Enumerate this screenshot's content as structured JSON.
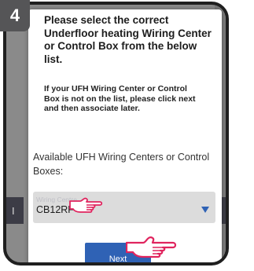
{
  "step": {
    "number": "4"
  },
  "dialog": {
    "title": "Please select the correct Underfloor heating Wiring Center or Control Box from the below list.",
    "note": "If your UFH Wiring Center or Control Box is not on the list, please click next and then associate later.",
    "available_label": "Available UFH Wiring Centers or Control Boxes:",
    "select": {
      "label": "Wiring Centre",
      "value": "CB12RF"
    },
    "next_label": "Next"
  },
  "background": {
    "partial_text": "I"
  },
  "colors": {
    "accent": "#2f62b5",
    "badge": "#555557",
    "frame": "#1f1f1f"
  },
  "icons": {
    "dropdown": "triangle-down-icon",
    "pointer": "pointing-hand-icon"
  }
}
